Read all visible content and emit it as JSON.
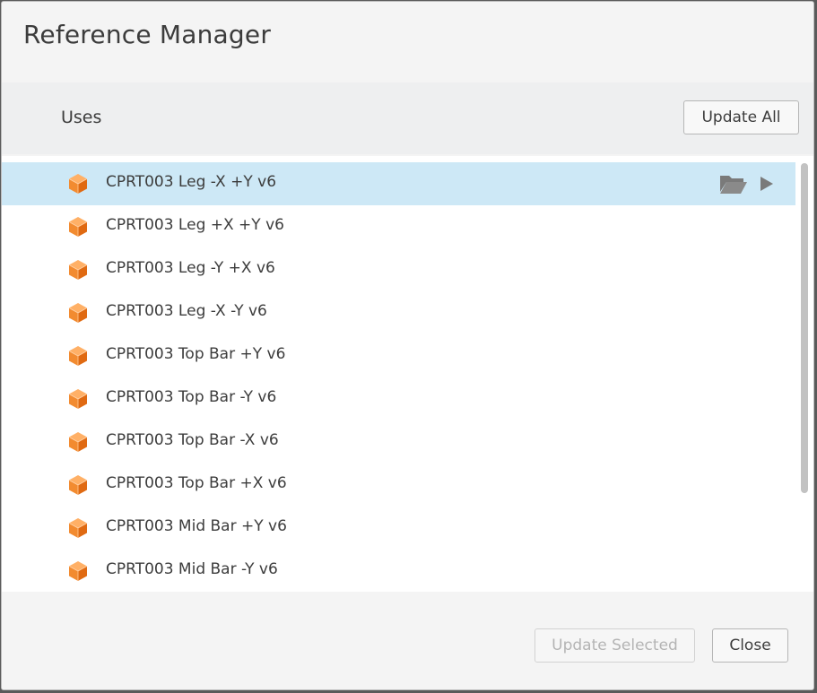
{
  "dialog": {
    "title": "Reference Manager"
  },
  "section": {
    "label": "Uses",
    "update_all_label": "Update All"
  },
  "references": [
    {
      "name": "CPRT003 Leg -X +Y v6",
      "selected": true
    },
    {
      "name": "CPRT003 Leg +X +Y v6",
      "selected": false
    },
    {
      "name": "CPRT003 Leg -Y +X v6",
      "selected": false
    },
    {
      "name": "CPRT003 Leg -X -Y v6",
      "selected": false
    },
    {
      "name": "CPRT003 Top Bar +Y v6",
      "selected": false
    },
    {
      "name": "CPRT003 Top Bar -Y v6",
      "selected": false
    },
    {
      "name": "CPRT003 Top Bar -X v6",
      "selected": false
    },
    {
      "name": "CPRT003 Top Bar +X v6",
      "selected": false
    },
    {
      "name": "CPRT003 Mid Bar +Y v6",
      "selected": false
    },
    {
      "name": "CPRT003 Mid Bar -Y v6",
      "selected": false
    }
  ],
  "row_icons": {
    "item": "component-cube-icon",
    "open_folder": "open-folder-icon",
    "expand": "play-arrow-icon"
  },
  "footer": {
    "update_selected_label": "Update Selected",
    "close_label": "Close"
  },
  "colors": {
    "selected_row": "#cde8f6",
    "cube_orange": "#f28b30"
  }
}
